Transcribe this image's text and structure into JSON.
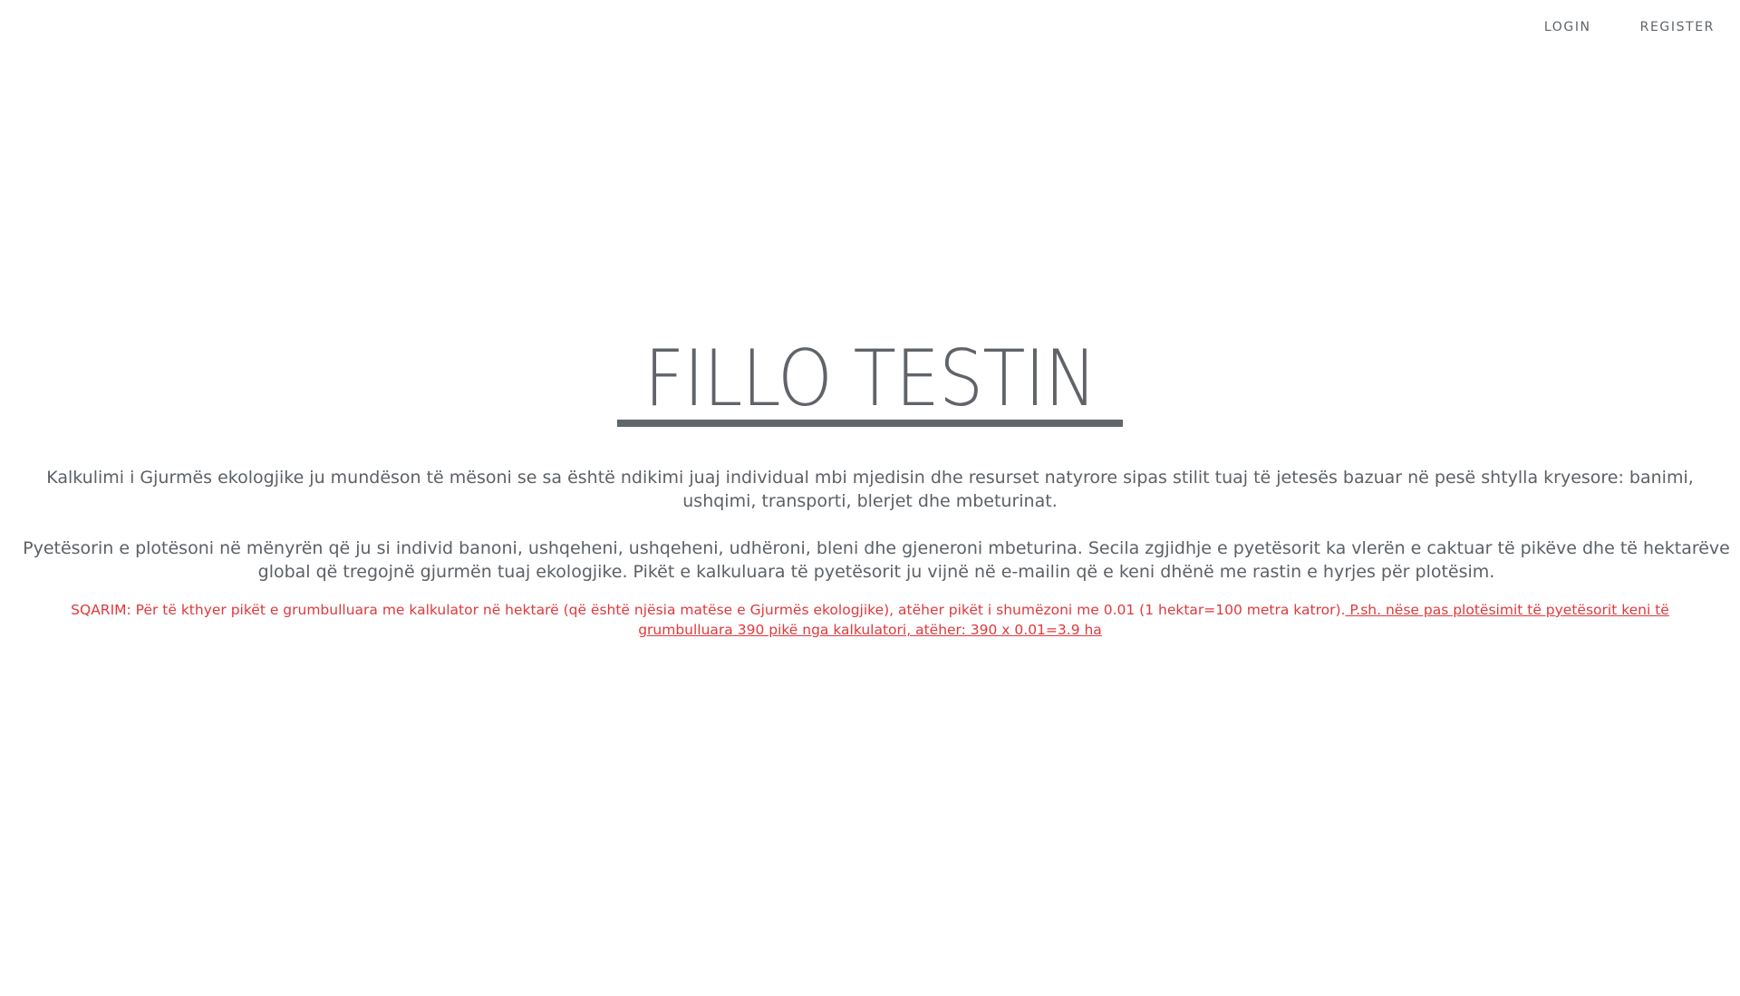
{
  "nav": {
    "login_label": "LOGIN",
    "register_label": "REGISTER"
  },
  "hero": {
    "title": "FILLO TESTIN"
  },
  "content": {
    "paragraph1": "Kalkulimi i Gjurmës ekologjike ju mundëson të mësoni se sa është ndikimi juaj individual mbi mjedisin dhe resurset natyrore sipas stilit tuaj të jetesës bazuar në pesë shtylla kryesore: banimi, ushqimi, transporti, blerjet dhe mbeturinat.",
    "paragraph2": "Pyetësorin e plotësoni në mënyrën që ju si individ banoni, ushqeheni, ushqeheni, udhëroni, bleni dhe gjeneroni mbeturina. Secila zgjidhje e pyetësorit ka vlerën e caktuar të pikëve dhe të hektarëve global që tregojnë gjurmën tuaj ekologjike. Pikët e kalkuluara të pyetësorit ju vijnë në e-mailin që e keni dhënë me rastin e hyrjes për plotësim.",
    "note_text": "SQARIM: Për të kthyer pikët e grumbulluara me kalkulator në hektarë (që është njësia matëse e Gjurmës ekologjike), atëher pikët i shumëzoni me 0.01 (1 hektar=100 metra katror).",
    "note_link": " P.sh. nëse pas plotësimit të pyetësorit keni të grumbulluara 390 pikë nga kalkulatori, atëher: 390 x 0.01=3.9 ha"
  },
  "colors": {
    "text": "#5c6166",
    "note": "#e0393c",
    "underline": "#5f676b"
  }
}
